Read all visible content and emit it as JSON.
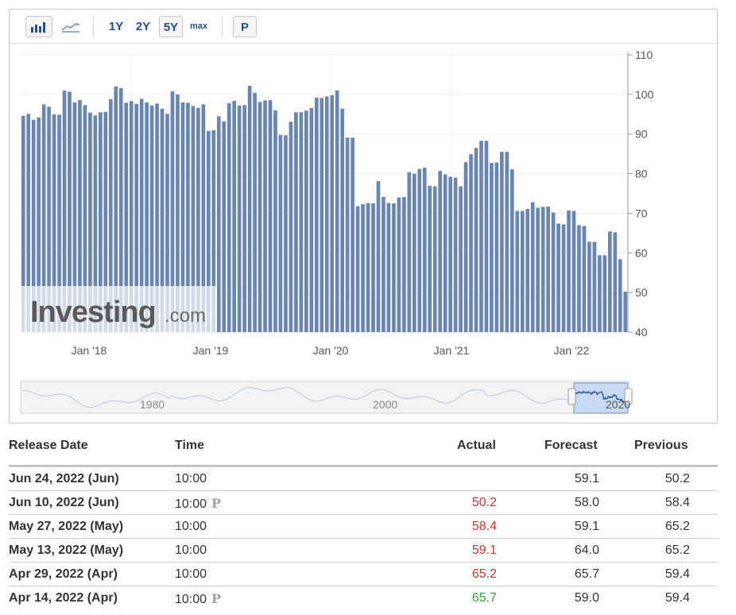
{
  "toolbar": {
    "bar_icon": "bar-chart-icon",
    "area_icon": "area-chart-icon",
    "range_1y": "1Y",
    "range_2y": "2Y",
    "range_5y": "5Y",
    "range_max": "max",
    "preliminary": "P",
    "selected_range": "5Y"
  },
  "watermark": {
    "brand": "Investing",
    "suffix": ".com"
  },
  "navigator": {
    "labels": [
      "1980",
      "2000",
      "2020"
    ]
  },
  "colors": {
    "bar": "#6985b2",
    "accent": "#1f4e9a",
    "negative": "#e0302b",
    "positive": "#39a13a"
  },
  "chart_data": {
    "type": "bar",
    "title": "",
    "x_tick_labels": [
      "Jan '18",
      "Jan '19",
      "Jan '20",
      "Jan '21",
      "Jan '22"
    ],
    "y_tick_labels": [
      "40",
      "50",
      "60",
      "70",
      "80",
      "90",
      "100",
      "110"
    ],
    "ylim": [
      40,
      110
    ],
    "grid": true,
    "y_axis_position": "right",
    "values": [
      94.6,
      95.1,
      93.6,
      94.2,
      97.5,
      96.9,
      95.0,
      94.9,
      101.0,
      100.7,
      98.0,
      98.6,
      97.3,
      95.4,
      94.7,
      95.5,
      95.6,
      98.8,
      102.0,
      101.6,
      97.9,
      98.3,
      97.6,
      98.9,
      98.0,
      97.2,
      97.7,
      96.4,
      95.1,
      100.8,
      100.0,
      98.0,
      97.9,
      97.1,
      96.6,
      97.5,
      90.8,
      91.0,
      94.5,
      93.2,
      97.8,
      98.4,
      97.2,
      97.3,
      102.2,
      100.4,
      98.1,
      98.5,
      98.6,
      96.0,
      89.8,
      89.7,
      93.1,
      95.5,
      95.5,
      95.9,
      96.6,
      99.2,
      99.1,
      99.5,
      99.8,
      101.0,
      96.4,
      89.1,
      89.1,
      71.8,
      72.3,
      72.6,
      72.5,
      78.1,
      74.1,
      72.6,
      72.5,
      74.0,
      74.1,
      80.4,
      80.0,
      81.2,
      81.5,
      76.9,
      76.8,
      80.7,
      79.8,
      79.2,
      79.0,
      76.8,
      82.9,
      84.9,
      86.5,
      88.3,
      88.3,
      82.7,
      82.8,
      85.5,
      85.5,
      81.1,
      70.6,
      70.6,
      71.1,
      72.8,
      71.4,
      71.6,
      71.7,
      70.2,
      67.4,
      67.2,
      70.7,
      70.6,
      67.0,
      66.8,
      62.8,
      62.8,
      59.4,
      59.4,
      65.4,
      65.2,
      58.4,
      50.2
    ],
    "release_table": {
      "headers": {
        "date": "Release Date",
        "time": "Time",
        "actual": "Actual",
        "forecast": "Forecast",
        "previous": "Previous"
      },
      "rows": [
        {
          "date": "Jun 24, 2022 (Jun)",
          "time": "10:00",
          "prelim": "",
          "actual": "",
          "actual_color": "neutral",
          "forecast": "59.1",
          "previous": "50.2"
        },
        {
          "date": "Jun 10, 2022 (Jun)",
          "time": "10:00",
          "prelim": "P",
          "actual": "50.2",
          "actual_color": "negative",
          "forecast": "58.0",
          "previous": "58.4"
        },
        {
          "date": "May 27, 2022 (May)",
          "time": "10:00",
          "prelim": "",
          "actual": "58.4",
          "actual_color": "negative",
          "forecast": "59.1",
          "previous": "65.2"
        },
        {
          "date": "May 13, 2022 (May)",
          "time": "10:00",
          "prelim": "",
          "actual": "59.1",
          "actual_color": "negative",
          "forecast": "64.0",
          "previous": "65.2"
        },
        {
          "date": "Apr 29, 2022 (Apr)",
          "time": "10:00",
          "prelim": "",
          "actual": "65.2",
          "actual_color": "negative",
          "forecast": "65.7",
          "previous": "59.4"
        },
        {
          "date": "Apr 14, 2022 (Apr)",
          "time": "10:00",
          "prelim": "P",
          "actual": "65.7",
          "actual_color": "positive",
          "forecast": "59.0",
          "previous": "59.4"
        }
      ]
    }
  }
}
